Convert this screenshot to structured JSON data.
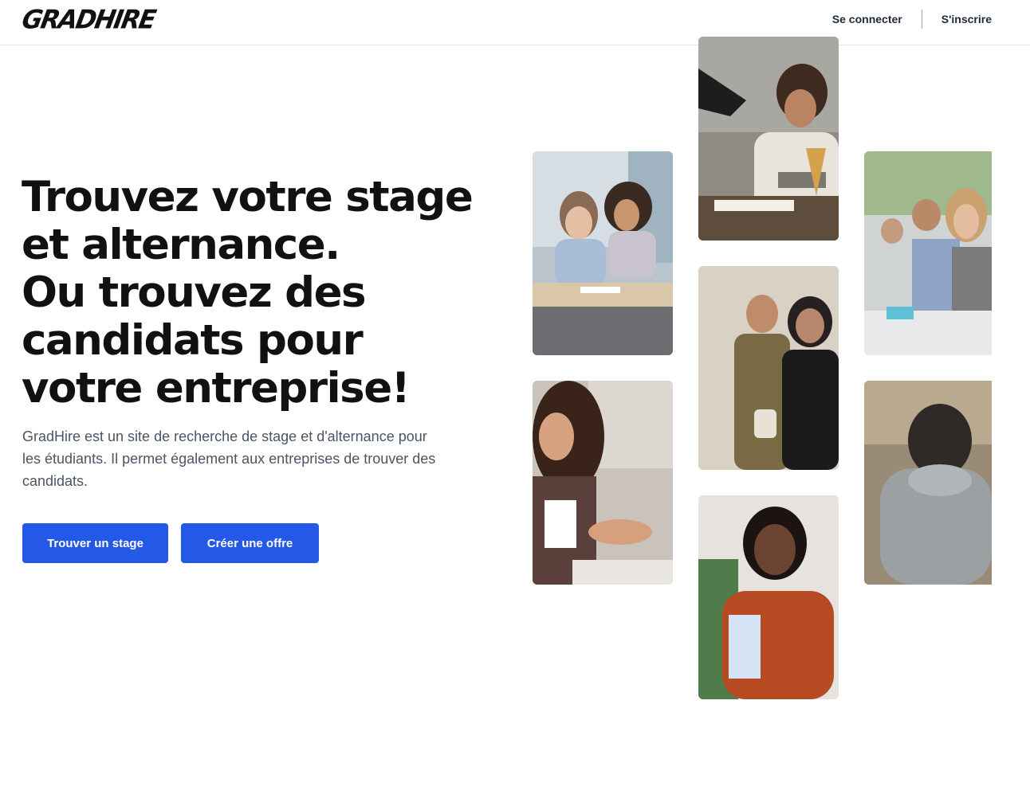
{
  "header": {
    "logo": "GRADHIRE",
    "login_label": "Se connecter",
    "signup_label": "S'inscrire"
  },
  "hero": {
    "title_lines": [
      "Trouvez votre stage",
      "et alternance.",
      "Ou trouvez des",
      "candidats pour",
      "votre entreprise!"
    ],
    "description": "GradHire est un site de recherche de stage et d'alternance pour les étudiants. Il permet également aux entreprises de trouver des candidats.",
    "find_button": "Trouver un stage",
    "create_button": "Créer une offre"
  },
  "colors": {
    "primary": "#2458e6",
    "text": "#111111",
    "muted": "#4b5563",
    "border": "#e5e7eb"
  }
}
